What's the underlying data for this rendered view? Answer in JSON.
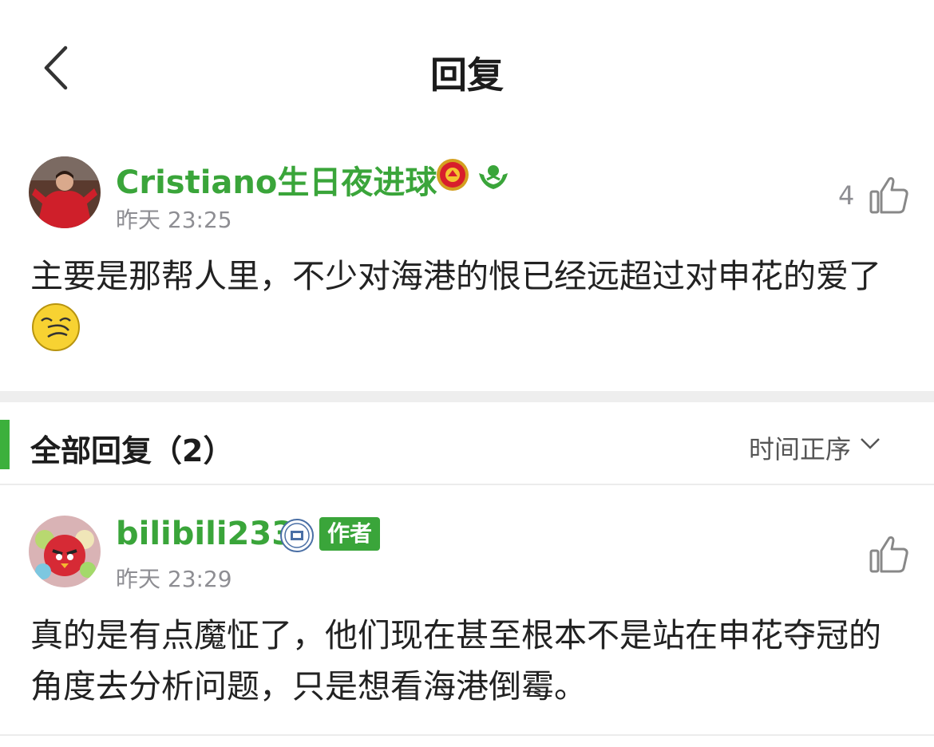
{
  "header": {
    "title": "回复"
  },
  "main_comment": {
    "username": "Cristiano生日夜进球",
    "time": "昨天 23:25",
    "like_count": "4",
    "content": "主要是那帮人里，不少对海港的恨已经远超过对申花的爱了",
    "badges": [
      "manchester-united-badge-icon",
      "club-badge-icon"
    ],
    "emoji": "smirk-emoji-icon"
  },
  "replies_section": {
    "title": "全部回复（2）",
    "sort_label": "时间正序"
  },
  "replies": [
    {
      "username": "bilibili233",
      "author_tag": "作者",
      "time": "昨天 23:29",
      "content": "真的是有点魔怔了，他们现在甚至根本不是站在申花夺冠的角度去分析问题，只是想看海港倒霉。"
    }
  ],
  "colors": {
    "accent": "#3aa53a",
    "section_bar": "#3cb03c",
    "muted": "#8e8e93"
  }
}
